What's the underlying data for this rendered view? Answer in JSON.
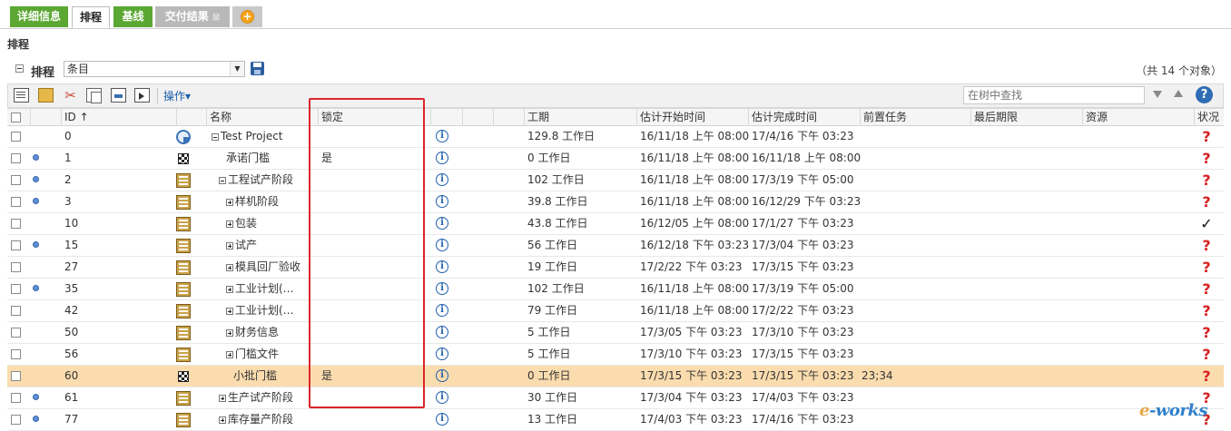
{
  "tabs": [
    {
      "label": "详细信息",
      "style": "green"
    },
    {
      "label": "排程",
      "style": "active"
    },
    {
      "label": "基线",
      "style": "green"
    },
    {
      "label": "交付结果",
      "style": "gray",
      "close": "⊠"
    }
  ],
  "section_title": "排程",
  "schedule": {
    "label": "排程",
    "view_value": "条目",
    "object_count": "（共 14 个对象）"
  },
  "toolbar": {
    "action_label": "操作▾",
    "search_placeholder": "在树中查找",
    "help": "?"
  },
  "columns": {
    "id": "ID ↑",
    "name": "名称",
    "lock": "锁定",
    "duration": "工期",
    "est_start": "估计开始时间",
    "est_finish": "估计完成时间",
    "predecessors": "前置任务",
    "deadline": "最后期限",
    "resources": "资源",
    "status": "状况"
  },
  "rows": [
    {
      "id": "0",
      "name": "Test Project",
      "indent": 0,
      "expander": "minus",
      "type_icon": "project-icon",
      "dot": false,
      "lock": "",
      "duration": "129.8 工作日",
      "est_start": "16/11/18 上午 08:00",
      "est_finish": "17/4/16 下午 03:23",
      "pred": "",
      "status": "?",
      "status_kind": "unknown"
    },
    {
      "id": "1",
      "name": "承诺门槛",
      "indent": 2,
      "expander": "",
      "type_icon": "milestone-icon",
      "dot": true,
      "lock": "是",
      "duration": "0 工作日",
      "est_start": "16/11/18 上午 08:00",
      "est_finish": "16/11/18 上午 08:00",
      "pred": "",
      "status": "?",
      "status_kind": "unknown"
    },
    {
      "id": "2",
      "name": "工程试产阶段",
      "indent": 1,
      "expander": "minus",
      "type_icon": "summary-task-icon",
      "dot": true,
      "lock": "",
      "duration": "102 工作日",
      "est_start": "16/11/18 上午 08:00",
      "est_finish": "17/3/19 下午 05:00",
      "pred": "",
      "status": "?",
      "status_kind": "unknown"
    },
    {
      "id": "3",
      "name": "样机阶段",
      "indent": 2,
      "expander": "plus",
      "type_icon": "summary-task-icon",
      "dot": true,
      "lock": "",
      "duration": "39.8 工作日",
      "est_start": "16/11/18 上午 08:00",
      "est_finish": "16/12/29 下午 03:23",
      "pred": "",
      "status": "?",
      "status_kind": "unknown"
    },
    {
      "id": "10",
      "name": "包装",
      "indent": 2,
      "expander": "plus",
      "type_icon": "summary-task-icon",
      "dot": false,
      "lock": "",
      "duration": "43.8 工作日",
      "est_start": "16/12/05 上午 08:00",
      "est_finish": "17/1/27 下午 03:23",
      "pred": "",
      "status": "✓",
      "status_kind": "done"
    },
    {
      "id": "15",
      "name": "试产",
      "indent": 2,
      "expander": "plus",
      "type_icon": "summary-task-icon",
      "dot": true,
      "lock": "",
      "duration": "56 工作日",
      "est_start": "16/12/18 下午 03:23",
      "est_finish": "17/3/04 下午 03:23",
      "pred": "",
      "status": "?",
      "status_kind": "unknown"
    },
    {
      "id": "27",
      "name": "模具回厂验收",
      "indent": 2,
      "expander": "plus",
      "type_icon": "summary-task-icon",
      "dot": false,
      "lock": "",
      "duration": "19 工作日",
      "est_start": "17/2/22 下午 03:23",
      "est_finish": "17/3/15 下午 03:23",
      "pred": "",
      "status": "?",
      "status_kind": "unknown"
    },
    {
      "id": "35",
      "name": "工业计划(…",
      "indent": 2,
      "expander": "plus",
      "type_icon": "summary-task-icon",
      "dot": true,
      "lock": "",
      "duration": "102 工作日",
      "est_start": "16/11/18 上午 08:00",
      "est_finish": "17/3/19 下午 05:00",
      "pred": "",
      "status": "?",
      "status_kind": "unknown"
    },
    {
      "id": "42",
      "name": "工业计划(…",
      "indent": 2,
      "expander": "plus",
      "type_icon": "summary-task-icon",
      "dot": false,
      "lock": "",
      "duration": "79 工作日",
      "est_start": "16/11/18 上午 08:00",
      "est_finish": "17/2/22 下午 03:23",
      "pred": "",
      "status": "?",
      "status_kind": "unknown"
    },
    {
      "id": "50",
      "name": "财务信息",
      "indent": 2,
      "expander": "plus",
      "type_icon": "summary-task-icon",
      "dot": false,
      "lock": "",
      "duration": "5 工作日",
      "est_start": "17/3/05 下午 03:23",
      "est_finish": "17/3/10 下午 03:23",
      "pred": "",
      "status": "?",
      "status_kind": "unknown"
    },
    {
      "id": "56",
      "name": "门槛文件",
      "indent": 2,
      "expander": "plus",
      "type_icon": "summary-task-icon",
      "dot": false,
      "lock": "",
      "duration": "5 工作日",
      "est_start": "17/3/10 下午 03:23",
      "est_finish": "17/3/15 下午 03:23",
      "pred": "",
      "status": "?",
      "status_kind": "unknown"
    },
    {
      "id": "60",
      "name": "小批门槛",
      "indent": 3,
      "expander": "",
      "type_icon": "milestone-icon",
      "dot": false,
      "lock": "是",
      "duration": "0 工作日",
      "est_start": "17/3/15 下午 03:23",
      "est_finish": "17/3/15 下午 03:23",
      "pred": "23;34",
      "status": "?",
      "status_kind": "unknown",
      "highlight": true
    },
    {
      "id": "61",
      "name": "生产试产阶段",
      "indent": 1,
      "expander": "plus",
      "type_icon": "summary-task-icon",
      "dot": true,
      "lock": "",
      "duration": "30 工作日",
      "est_start": "17/3/04 下午 03:23",
      "est_finish": "17/4/03 下午 03:23",
      "pred": "",
      "status": "?",
      "status_kind": "unknown"
    },
    {
      "id": "77",
      "name": "库存量产阶段",
      "indent": 1,
      "expander": "plus",
      "type_icon": "summary-task-icon",
      "dot": true,
      "lock": "",
      "duration": "13 工作日",
      "est_start": "17/4/03 下午 03:23",
      "est_finish": "17/4/16 下午 03:23",
      "pred": "",
      "status": "?",
      "status_kind": "unknown"
    }
  ],
  "watermark": {
    "text_a": "e",
    "text_b": "-works"
  },
  "colors": {
    "tab_green": "#5aa832",
    "highlight_row": "#fbdcae",
    "annotation_red": "#d9262b",
    "unknown_status": "#d61f1f"
  }
}
